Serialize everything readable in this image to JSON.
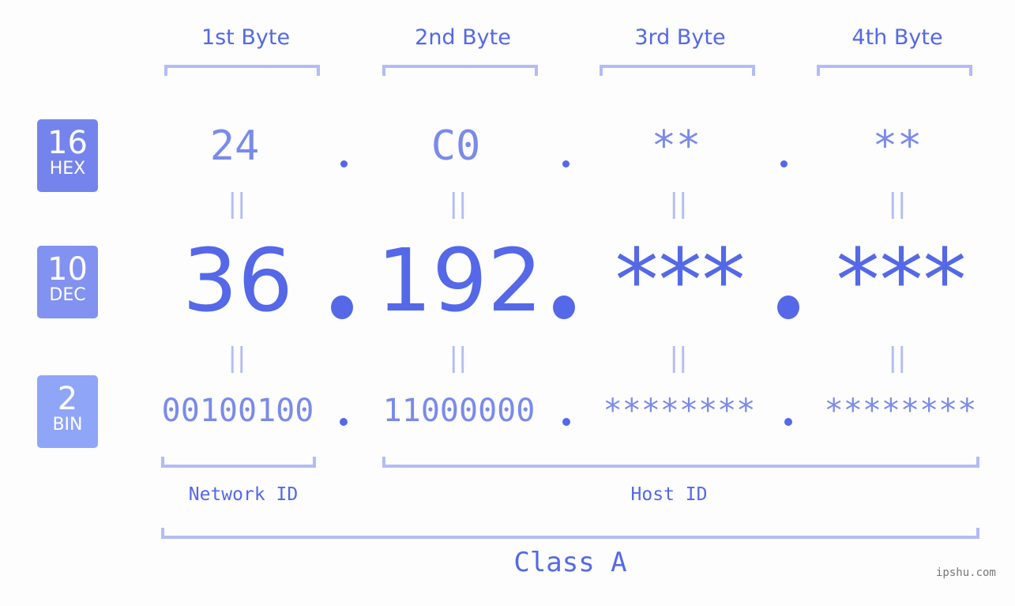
{
  "bytes": [
    {
      "header": "1st Byte",
      "hex": "24",
      "dec": "36",
      "bin": "00100100"
    },
    {
      "header": "2nd Byte",
      "hex": "C0",
      "dec": "192",
      "bin": "11000000"
    },
    {
      "header": "3rd Byte",
      "hex": "**",
      "dec": "***",
      "bin": "********"
    },
    {
      "header": "4th Byte",
      "hex": "**",
      "dec": "***",
      "bin": "********"
    }
  ],
  "badges": {
    "hex": {
      "num": "16",
      "label": "HEX",
      "color": "#7584ec"
    },
    "dec": {
      "num": "10",
      "label": "DEC",
      "color": "#8292f0"
    },
    "bin": {
      "num": "2",
      "label": "BIN",
      "color": "#8fa5f8"
    }
  },
  "equals_symbol": "||",
  "segments": {
    "network": "Network ID",
    "host": "Host ID",
    "class": "Class A"
  },
  "credit": "ipshu.com",
  "colors": {
    "accent": "#5468e8",
    "light": "#7a8aeb",
    "bracket": "#b3bcf5"
  }
}
